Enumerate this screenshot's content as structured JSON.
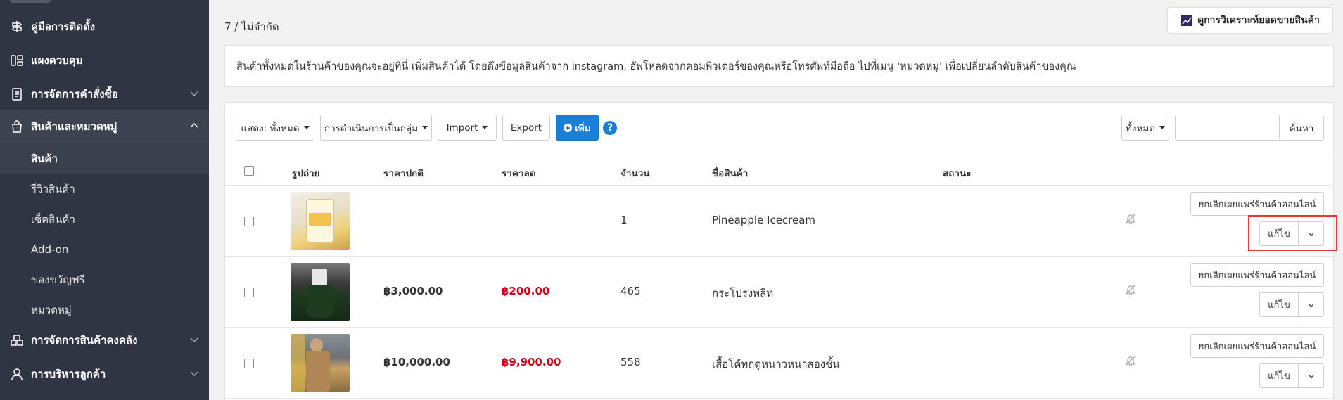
{
  "sidebar": {
    "items": [
      {
        "label": "คู่มือการติดตั้ง",
        "icon": "signpost-icon"
      },
      {
        "label": "แผงควบคุม",
        "icon": "dashboard-icon"
      },
      {
        "label": "การจัดการคำสั่งซื้อ",
        "icon": "receipt-icon"
      },
      {
        "label": "สินค้าและหมวดหมู่",
        "icon": "shopping-bag-icon"
      },
      {
        "label": "การจัดการสินค้าคงคลัง",
        "icon": "warehouse-icon"
      },
      {
        "label": "การบริหารลูกค้า",
        "icon": "user-icon"
      }
    ],
    "sub_items": [
      "สินค้า",
      "รีวิวสินค้า",
      "เซ็ตสินค้า",
      "Add-on",
      "ของขวัญฟรี",
      "หมวดหมู่"
    ]
  },
  "header": {
    "limit": "7 / ไม่จำกัด",
    "analysis_button": "ดูการวิเคราะห์ยอดขายสินค้า"
  },
  "info": "สินค้าทั้งหมดในร้านค้าของคุณจะอยู่ที่นี่ เพิ่มสินค้าได้ โดยดึงข้อมูลสินค้าจาก instagram, อัพโหลดจากคอมพิวเตอร์ของคุณหรือโทรศัพท์มือถือ ไปที่เมนู 'หมวดหมู่' เพื่อเปลี่ยนลำดับสินค้าของคุณ",
  "toolbar": {
    "show": "แสดง: ทั้งหมด",
    "bulk": "การดำเนินการเป็นกลุ่ม",
    "import": "Import",
    "export": "Export",
    "add": "เพิ่ม",
    "help": "?",
    "filter": "ทั้งหมด",
    "search_value": "",
    "search_button": "ค้นหา"
  },
  "table": {
    "headers": {
      "photo": "รูปถ่าย",
      "price": "ราคาปกติ",
      "sale": "ราคาลด",
      "qty": "จำนวน",
      "name": "ชื่อสินค้า",
      "status": "สถานะ"
    },
    "rows": [
      {
        "price": "",
        "sale": "",
        "qty": "1",
        "name": "Pineapple Icecream",
        "unpublish": "ยกเลิกเผยแพร่ร้านค้าออนไลน์",
        "edit": "แก้ไข"
      },
      {
        "price": "฿3,000.00",
        "sale": "฿200.00",
        "qty": "465",
        "name": "กระโปรงพลีท",
        "unpublish": "ยกเลิกเผยแพร่ร้านค้าออนไลน์",
        "edit": "แก้ไข"
      },
      {
        "price": "฿10,000.00",
        "sale": "฿9,900.00",
        "qty": "558",
        "name": "เสื้อโค้ทฤดูหนาวหนาสองชั้น",
        "unpublish": "ยกเลิกเผยแพร่ร้านค้าออนไลน์",
        "edit": "แก้ไข"
      }
    ]
  },
  "colors": {
    "sidebar_bg": "#2f3542",
    "primary": "#1a7fd6",
    "sale_price": "#d0021b",
    "highlight": "#e53935"
  }
}
